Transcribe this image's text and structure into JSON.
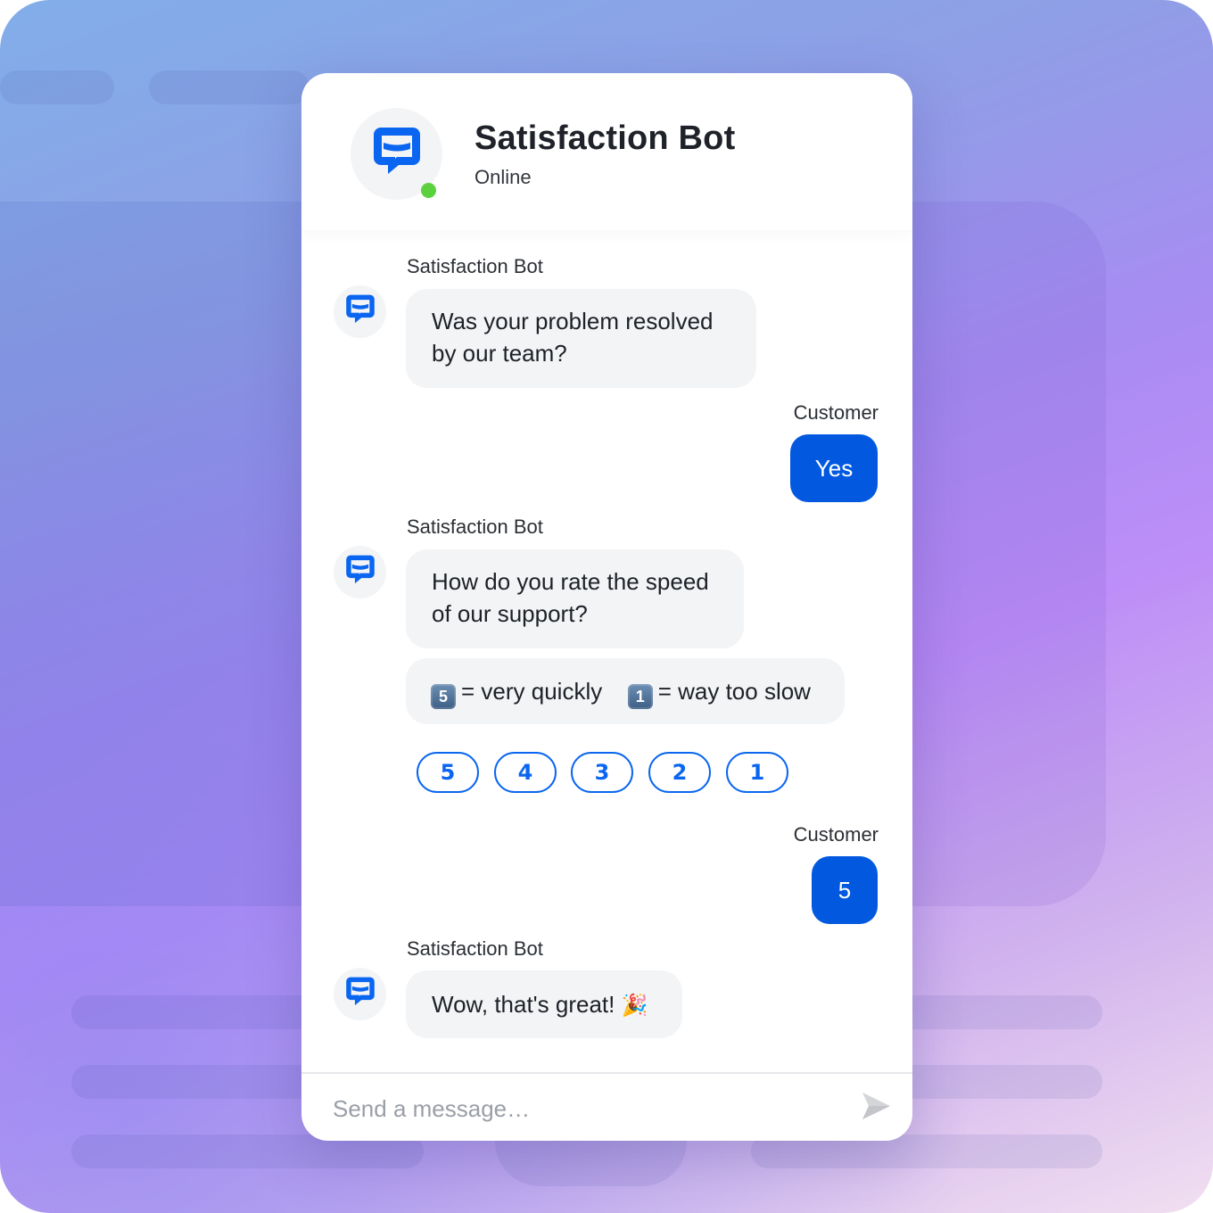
{
  "colors": {
    "accent": "#0259e0",
    "rating_outline": "#0a66f0",
    "online": "#5cd13f",
    "bubble_bg": "#f3f4f6"
  },
  "header": {
    "title": "Satisfaction Bot",
    "status": "Online",
    "avatar_icon": "chat-bubble-icon"
  },
  "messages": [
    {
      "author": "Satisfaction Bot",
      "role": "bot",
      "text": "Was your problem resolved by our team?",
      "lines": [
        "Was your problem resolved",
        "by our team?"
      ]
    },
    {
      "author": "Customer",
      "role": "customer",
      "text": "Yes"
    },
    {
      "author": "Satisfaction Bot",
      "role": "bot",
      "text": "How do you rate the speed of our support?",
      "lines": [
        "How do you rate the speed",
        "of our support?"
      ]
    },
    {
      "author": "",
      "role": "bot",
      "scale": {
        "high_key": "5",
        "high_label": "= very quickly",
        "low_key": "1",
        "low_label": "= way too slow"
      }
    },
    {
      "author": "Customer",
      "role": "customer",
      "text": "5"
    },
    {
      "author": "Satisfaction Bot",
      "role": "bot",
      "text": "Wow, that's great!",
      "emoji": "🎉"
    }
  ],
  "rating_options": [
    "5",
    "4",
    "3",
    "2",
    "1"
  ],
  "composer": {
    "placeholder": "Send a message…",
    "send_icon": "send-icon"
  }
}
